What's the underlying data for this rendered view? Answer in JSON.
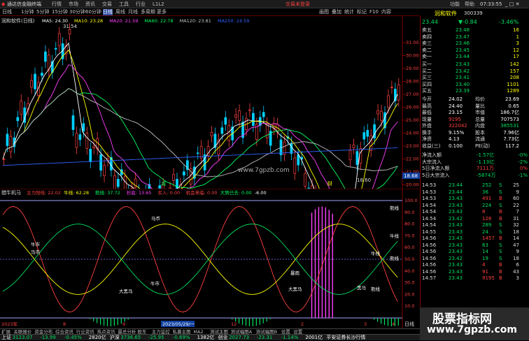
{
  "window": {
    "app_title": "通达信金融终端",
    "menus": [
      "行情",
      "市场",
      "资讯",
      "交易",
      "工具",
      "行业",
      "L1L2"
    ],
    "ad_text": "交易未登录",
    "right_menus": [
      "功能",
      "帮助"
    ],
    "time": "07:33:55"
  },
  "toolbar": {
    "periods": [
      "日线",
      "1分钟",
      "5分钟",
      "15分钟",
      "30分钟",
      "60分钟",
      "日线",
      "周线",
      "月线",
      "多周期",
      "更多"
    ],
    "right_buttons": [
      "画图",
      "叠加",
      "统计",
      "标记",
      "F10",
      "内容"
    ]
  },
  "main_chart": {
    "title": "润和软件(日线)",
    "ma_labels": [
      "MA5: 24.30",
      "MA10: 23.28",
      "MA20: 21.59",
      "MA60: 22.78",
      "MA120: 23.81",
      "MA250: 24.59"
    ],
    "ma_colors": [
      "#ffffff",
      "#ffff00",
      "#ff40ff",
      "#00ff60",
      "#c0c0c0",
      "#3060ff"
    ],
    "price_ticks": [
      "31.00",
      "30.00",
      "29.00",
      "28.00",
      "27.00",
      "26.00",
      "25.00",
      "24.00",
      "23.00",
      "22.00",
      "21.00",
      "20.00",
      "19.00"
    ],
    "high_label": "31.54",
    "low_label": "18.60",
    "current_price_tag": "18.68",
    "watermark": "www.7gpzb.com",
    "markers": [
      "减",
      "财"
    ]
  },
  "indicator": {
    "title": "猎牛机马",
    "labels": [
      {
        "text": "主力阳线: 22.02",
        "color": "#ff4040"
      },
      {
        "text": "牛线: 62.28",
        "color": "#ffff00"
      },
      {
        "text": "熊线: 37.72",
        "color": "#00ff60"
      },
      {
        "text": "抄底: 13.65",
        "color": "#ff40ff"
      },
      {
        "text": "买入: 0.00",
        "color": "#ff4040"
      },
      {
        "text": "机会来临: 0.00",
        "color": "#ff4040"
      },
      {
        "text": "大势已去: 0.00",
        "color": "#00ff60"
      },
      {
        "text": "-6.00",
        "color": "#ffffff"
      }
    ],
    "ticks": [
      "100.0",
      "90.0",
      "80.0",
      "70.0",
      "60.0",
      "50.0",
      "40.0",
      "30.0",
      "20.0",
      "10.0"
    ],
    "annotations": [
      "熊线",
      "马币",
      "牛市",
      "马市",
      "牛线",
      "熊线",
      "大黑马",
      "暴雨",
      "牛市",
      "牛线",
      "熊线",
      "黑马",
      "大黑马"
    ],
    "dates": [
      "2023年",
      "8",
      "9",
      "10",
      "2023/05/29/一",
      "12",
      "2",
      "3",
      "4"
    ],
    "right_label": "日线"
  },
  "panel": {
    "stock_name": "润和软件",
    "stock_code": "300339",
    "price": "23.44",
    "change": "▼-0.84",
    "change_pct": "-3.46%",
    "asks": [
      {
        "label": "卖五",
        "price": "23.48",
        "vol": "16"
      },
      {
        "label": "卖四",
        "price": "23.47",
        "vol": "1"
      },
      {
        "label": "卖三",
        "price": "23.46",
        "vol": "3"
      },
      {
        "label": "卖二",
        "price": "23.45",
        "vol": "12"
      },
      {
        "label": "卖一",
        "price": "23.44",
        "vol": "17"
      }
    ],
    "bids": [
      {
        "label": "买一",
        "price": "23.43",
        "vol": "142"
      },
      {
        "label": "买二",
        "price": "23.42",
        "vol": "157"
      },
      {
        "label": "买三",
        "price": "23.41",
        "vol": "208"
      },
      {
        "label": "买四",
        "price": "23.40",
        "vol": "1101"
      },
      {
        "label": "买五",
        "price": "23.39",
        "vol": "1289"
      }
    ],
    "stats": [
      {
        "l1": "今开",
        "v1": "24.02",
        "l2": "均价",
        "v2": "23.69"
      },
      {
        "l1": "最高",
        "v1": "24.40",
        "l2": "量比",
        "v2": "0.65"
      },
      {
        "l1": "最低",
        "v1": "23.15",
        "l2": "市值",
        "v2": "186.7亿"
      },
      {
        "l1": "现量",
        "v1": "9195",
        "l2": "总量",
        "v2": "707573"
      },
      {
        "l1": "外盘",
        "v1": "322042",
        "l2": "内盘",
        "v2": "385531"
      },
      {
        "l1": "换手",
        "v1": "9.15%",
        "l2": "股本",
        "v2": "7.96亿"
      },
      {
        "l1": "净资",
        "v1": "4.13",
        "l2": "流通",
        "v2": "7.73亿"
      },
      {
        "l1": "收益(三)",
        "v1": "0.100",
        "l2": "PE(动)",
        "v2": "117.2"
      }
    ],
    "flows": [
      {
        "label": "净流入额",
        "v": "-1.57亿",
        "pct": "-0%"
      },
      {
        "label": "大宗流入",
        "v": "-1.13亿",
        "pct": "-2%"
      },
      {
        "label": "5日净流入额",
        "v": "7111万",
        "pct": "0%"
      },
      {
        "label": "5日大宗流入",
        "v": "-5874万",
        "pct": "-1%"
      }
    ],
    "ticks_list": [
      [
        "14:53",
        "23.44",
        "252",
        "S",
        "25"
      ],
      [
        "14:53",
        "23.44",
        "36",
        "S",
        "9"
      ],
      [
        "14:53",
        "23.43",
        "491",
        "B",
        "60"
      ],
      [
        "14:54",
        "23.43",
        "224",
        "S",
        "22"
      ],
      [
        "14:54",
        "23.43",
        "8",
        "B",
        "7"
      ],
      [
        "14:54",
        "23.42",
        "128",
        "B",
        "31"
      ],
      [
        "14:54",
        "23.43",
        "289",
        "S",
        "32"
      ],
      [
        "14:55",
        "23.43",
        "24",
        "S",
        "18"
      ],
      [
        "14:56",
        "23.43",
        "1457",
        "B",
        "14"
      ],
      [
        "14:56",
        "23.43",
        "63",
        "S",
        "47"
      ],
      [
        "14:56",
        "23.43",
        "14",
        "S",
        "9"
      ],
      [
        "14:56",
        "23.42",
        "19",
        "S",
        "18"
      ],
      [
        "14:56",
        "23.43",
        "4",
        "B",
        "6"
      ],
      [
        "14:56",
        "23.43",
        "91",
        "B",
        "43"
      ],
      [
        "14:57",
        "23.43",
        "9195",
        "B",
        "3"
      ]
    ]
  },
  "tabs": [
    "扩展",
    "关联报价",
    "资金分布",
    "综合资讯",
    "行业资讯",
    "热点资讯",
    "最总分析 股东",
    "主力监控",
    "私募主图",
    "MA2",
    "测试主图",
    "测试幅图A",
    "测试幅图B",
    "设置",
    "设置"
  ],
  "status": {
    "items": [
      {
        "text": "上证",
        "color": "#ffffff"
      },
      {
        "text": "3123.07",
        "color": "#00e060"
      },
      {
        "text": "-13.99",
        "color": "#00e060"
      },
      {
        "text": "-0.45%",
        "color": "#00e060"
      },
      {
        "text": "2820亿",
        "color": "#ffffff"
      },
      {
        "text": "沪深",
        "color": "#ffffff"
      },
      {
        "text": "3736.65",
        "color": "#00e060"
      },
      {
        "text": "-25.95",
        "color": "#00e060"
      },
      {
        "text": "-0.69%",
        "color": "#00e060"
      },
      {
        "text": "1382亿",
        "color": "#ffffff"
      },
      {
        "text": "创业",
        "color": "#ffffff"
      },
      {
        "text": "2027.73",
        "color": "#00e060"
      },
      {
        "text": "-23.31",
        "color": "#00e060"
      },
      {
        "text": "-1.14%",
        "color": "#00e060"
      },
      {
        "text": "2001亿",
        "color": "#ffffff"
      },
      {
        "text": "平安证券长沙行情",
        "color": "#ffffff"
      }
    ],
    "watermark_title": "股票指标网",
    "watermark_url": "www.7gpzb.com"
  }
}
